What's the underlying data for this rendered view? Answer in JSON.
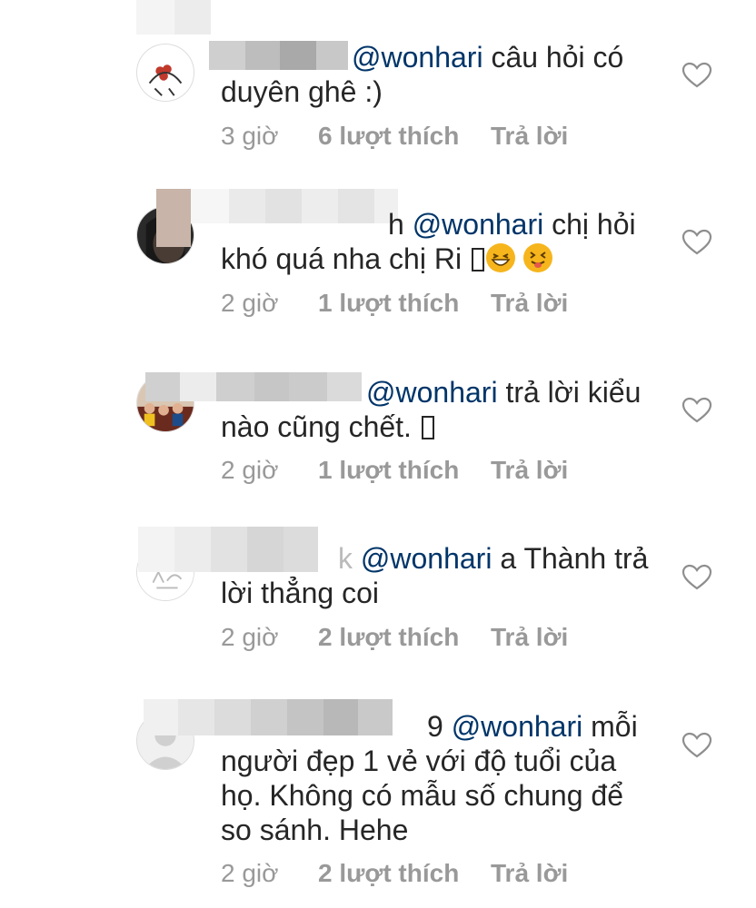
{
  "comments": [
    {
      "name_tail": "",
      "mention": "@wonhari",
      "text_before": "  câu hỏi có",
      "text_after": "duyên ghê :)",
      "time": "3 giờ",
      "likes": "6 lượt thích",
      "reply": "Trả lời"
    },
    {
      "name_tail": "h",
      "mention": "@wonhari",
      "text_before": " chị hỏi",
      "text_after": "khó quá nha chị Ri",
      "emojis": [
        "grinning-squinting-face",
        "squinting-face-with-tongue"
      ],
      "time": "2 giờ",
      "likes": "1 lượt thích",
      "reply": "Trả lời"
    },
    {
      "name_tail": "",
      "mention": "@wonhari",
      "text_before": " trả lời kiểu",
      "text_after": "nào cũng chết.",
      "time": "2 giờ",
      "likes": "1 lượt thích",
      "reply": "Trả lời"
    },
    {
      "name_tail": "k",
      "mention": "@wonhari",
      "text_before": " a Thành trả",
      "text_after": "lời thẳng coi",
      "time": "2 giờ",
      "likes": "2 lượt thích",
      "reply": "Trả lời"
    },
    {
      "name_tail": "9",
      "mention": "@wonhari",
      "text_before": " mỗi",
      "text_after": "người đẹp 1 vẻ với độ tuổi của họ. Không có mẫu số chung để so sánh. Hehe",
      "time": "2 giờ",
      "likes": "2 lượt thích",
      "reply": "Trả lời"
    }
  ],
  "colors": {
    "text": "#262626",
    "mention": "#003569",
    "meta": "#999999"
  },
  "icons": {
    "like": "heart-outline-icon"
  }
}
